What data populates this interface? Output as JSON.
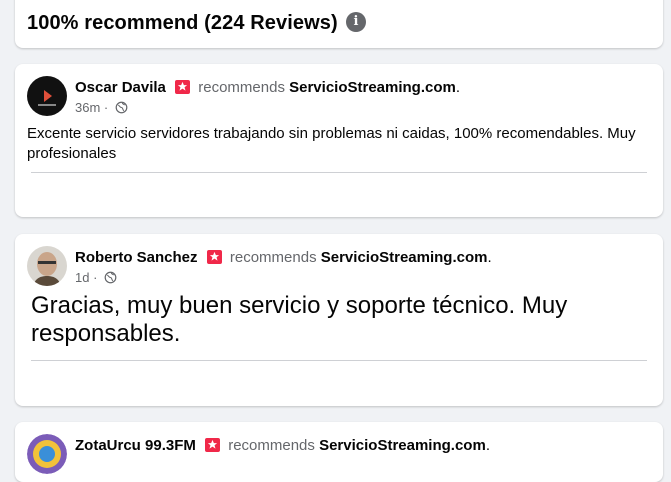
{
  "summary": {
    "title": "100% recommend (224 Reviews)",
    "info_icon": "info-icon"
  },
  "reviews": [
    {
      "name": "Oscar Davila",
      "recommend_word": "recommends",
      "page": "ServicioStreaming.com",
      "period": ".",
      "time": "36m",
      "separator": "·",
      "audience_icon": "globe-icon",
      "text": "Excente servicio servidores trabajando sin problemas ni caidas, 100% recomendables. Muy profesionales"
    },
    {
      "name": "Roberto Sanchez",
      "recommend_word": "recommends",
      "page": "ServicioStreaming.com",
      "period": ".",
      "time": "1d",
      "separator": "·",
      "audience_icon": "globe-icon",
      "text": "Gracias, muy buen servicio y soporte técnico. Muy responsables."
    },
    {
      "name": "ZotaUrcu 99.3FM",
      "recommend_word": "recommends",
      "page": "ServicioStreaming.com",
      "period": "."
    }
  ],
  "colors": {
    "background": "#f0f2f5",
    "card": "#ffffff",
    "recommend_badge": "#f02849",
    "secondary_text": "#65676b"
  }
}
